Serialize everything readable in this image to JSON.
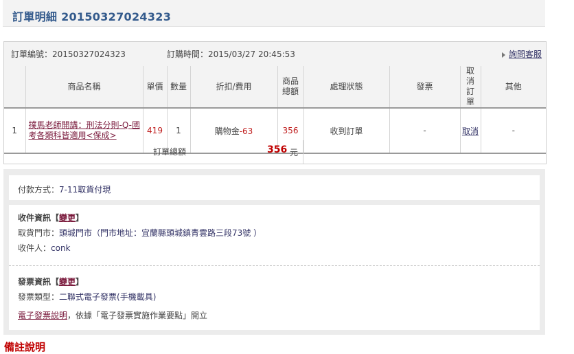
{
  "page_title": "訂單明細 20150327024323",
  "order_info": {
    "order_no_label": "訂單編號：",
    "order_no": "20150327024323",
    "order_time_label": "訂購時間：",
    "order_time": "2015/03/27 20:45:53",
    "help_link": "詢問客服"
  },
  "table": {
    "headers": {
      "name": "商品名稱",
      "price": "單價",
      "qty": "數量",
      "discount": "折扣/費用",
      "total": "商品總額",
      "status": "處理狀態",
      "invoice": "發票",
      "cancel": "取消訂單",
      "other": "其他"
    },
    "rows": [
      {
        "index": "1",
        "name": "撲馬老師開講：刑法分則-Q-國考各類科皆適用<保成>",
        "price": "419",
        "qty": "1",
        "discount_label": "購物金",
        "discount_value": "-63",
        "total": "356",
        "status": "收到訂單",
        "invoice": "-",
        "cancel": "取消",
        "other": "-"
      }
    ]
  },
  "order_total": {
    "label": "訂單總額",
    "amount": "356",
    "unit": "元"
  },
  "payment": {
    "label": "付款方式：",
    "method": "7-11取貨付現"
  },
  "shipping": {
    "title": "收件資訊【",
    "change": "變更",
    "title_end": "】",
    "store_label": "取貨門市：",
    "store_text": "頭城門市（門市地址：宜蘭縣頭城鎮青雲路三段73號 ）",
    "recipient_label": "收件人：",
    "recipient": "conk"
  },
  "invoice": {
    "title": "發票資訊【",
    "change": "變更",
    "title_end": "】",
    "type_label": "發票類型：",
    "type": "二聯式電子發票(手機載具)",
    "link": "電子發票說明",
    "note": "，依據「電子發票實施作業要點」開立"
  },
  "bottom_heading": "備註說明"
}
